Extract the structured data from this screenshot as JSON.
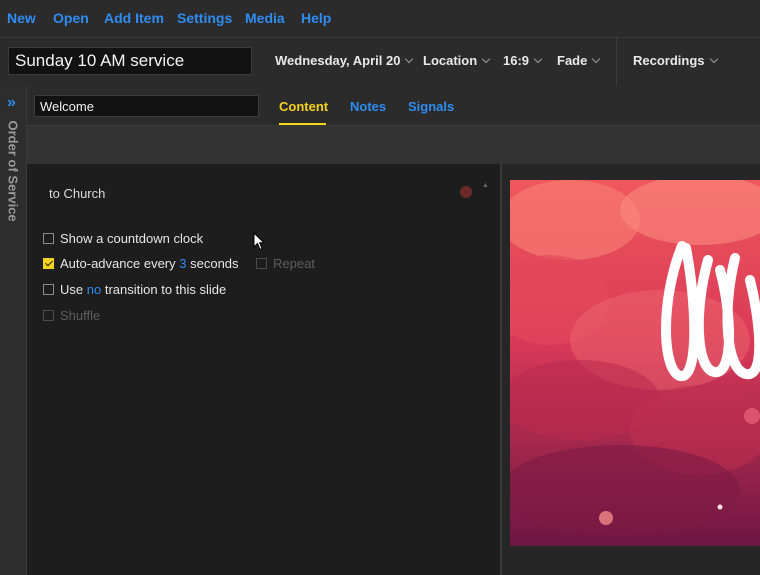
{
  "menu": {
    "items": [
      "New",
      "Open",
      "Add Item",
      "Settings",
      "Media",
      "Help"
    ]
  },
  "toolbar": {
    "service_title": "Sunday 10 AM service",
    "date": "Wednesday, April 20",
    "location": "Location",
    "aspect": "16:9",
    "transition": "Fade",
    "recordings": "Recordings"
  },
  "sidebar": {
    "label": "Order of Service",
    "expand_glyph": "»"
  },
  "item": {
    "name": "Welcome",
    "tabs": [
      "Content",
      "Notes",
      "Signals"
    ],
    "active_tab": "Content"
  },
  "slide": {
    "text": "to Church",
    "options": {
      "countdown": {
        "label": "Show a countdown clock",
        "checked": false
      },
      "auto_advance": {
        "prefix": "Auto-advance every",
        "value": "3",
        "suffix": "seconds",
        "checked": true
      },
      "repeat": {
        "label": "Repeat",
        "checked": false,
        "disabled": true
      },
      "transition": {
        "prefix": "Use",
        "value": "no",
        "suffix": "transition to this slide",
        "checked": false
      },
      "shuffle": {
        "label": "Shuffle",
        "checked": false,
        "disabled": true
      }
    }
  },
  "colors": {
    "accent": "#2f8cf1",
    "active_tab": "#f5d21b",
    "checkbox_checked": "#f5d21b",
    "background": "#1d1d1d"
  },
  "icons": [
    "expand-sidebar-icon",
    "chevron-down-icon",
    "record-dot-icon",
    "mouse-cursor-icon"
  ]
}
